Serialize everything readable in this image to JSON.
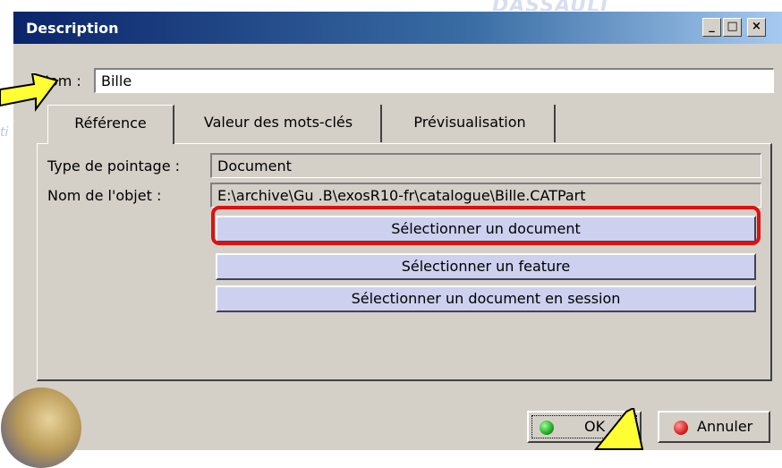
{
  "watermark": "DASSAULT",
  "watermark_side": "ti",
  "window": {
    "title": "Description",
    "controls": {
      "minimize": "_",
      "maximize": "□",
      "close": "×"
    }
  },
  "name_field": {
    "label": "Nom :",
    "value": "Bille"
  },
  "tabs": [
    {
      "label": "Référence",
      "active": true
    },
    {
      "label": "Valeur des mots-clés",
      "active": false
    },
    {
      "label": "Prévisualisation",
      "active": false
    }
  ],
  "reference": {
    "pointing_type_label": "Type de pointage :",
    "pointing_type_value": "Document",
    "object_name_label": "Nom de l'objet :",
    "object_name_value": "E:\\archive\\Gu .B\\exosR10-fr\\catalogue\\Bille.CATPart",
    "buttons": {
      "select_document": "Sélectionner un document",
      "select_feature": "Sélectionner un feature",
      "select_document_in_session": "Sélectionner un document en session"
    }
  },
  "dialog_buttons": {
    "ok": "OK",
    "cancel": "Annuler"
  },
  "colors": {
    "highlight": "#e01010",
    "callout": "#ffff33",
    "ok_dot": "#22aa22",
    "cancel_dot": "#dd2222"
  }
}
